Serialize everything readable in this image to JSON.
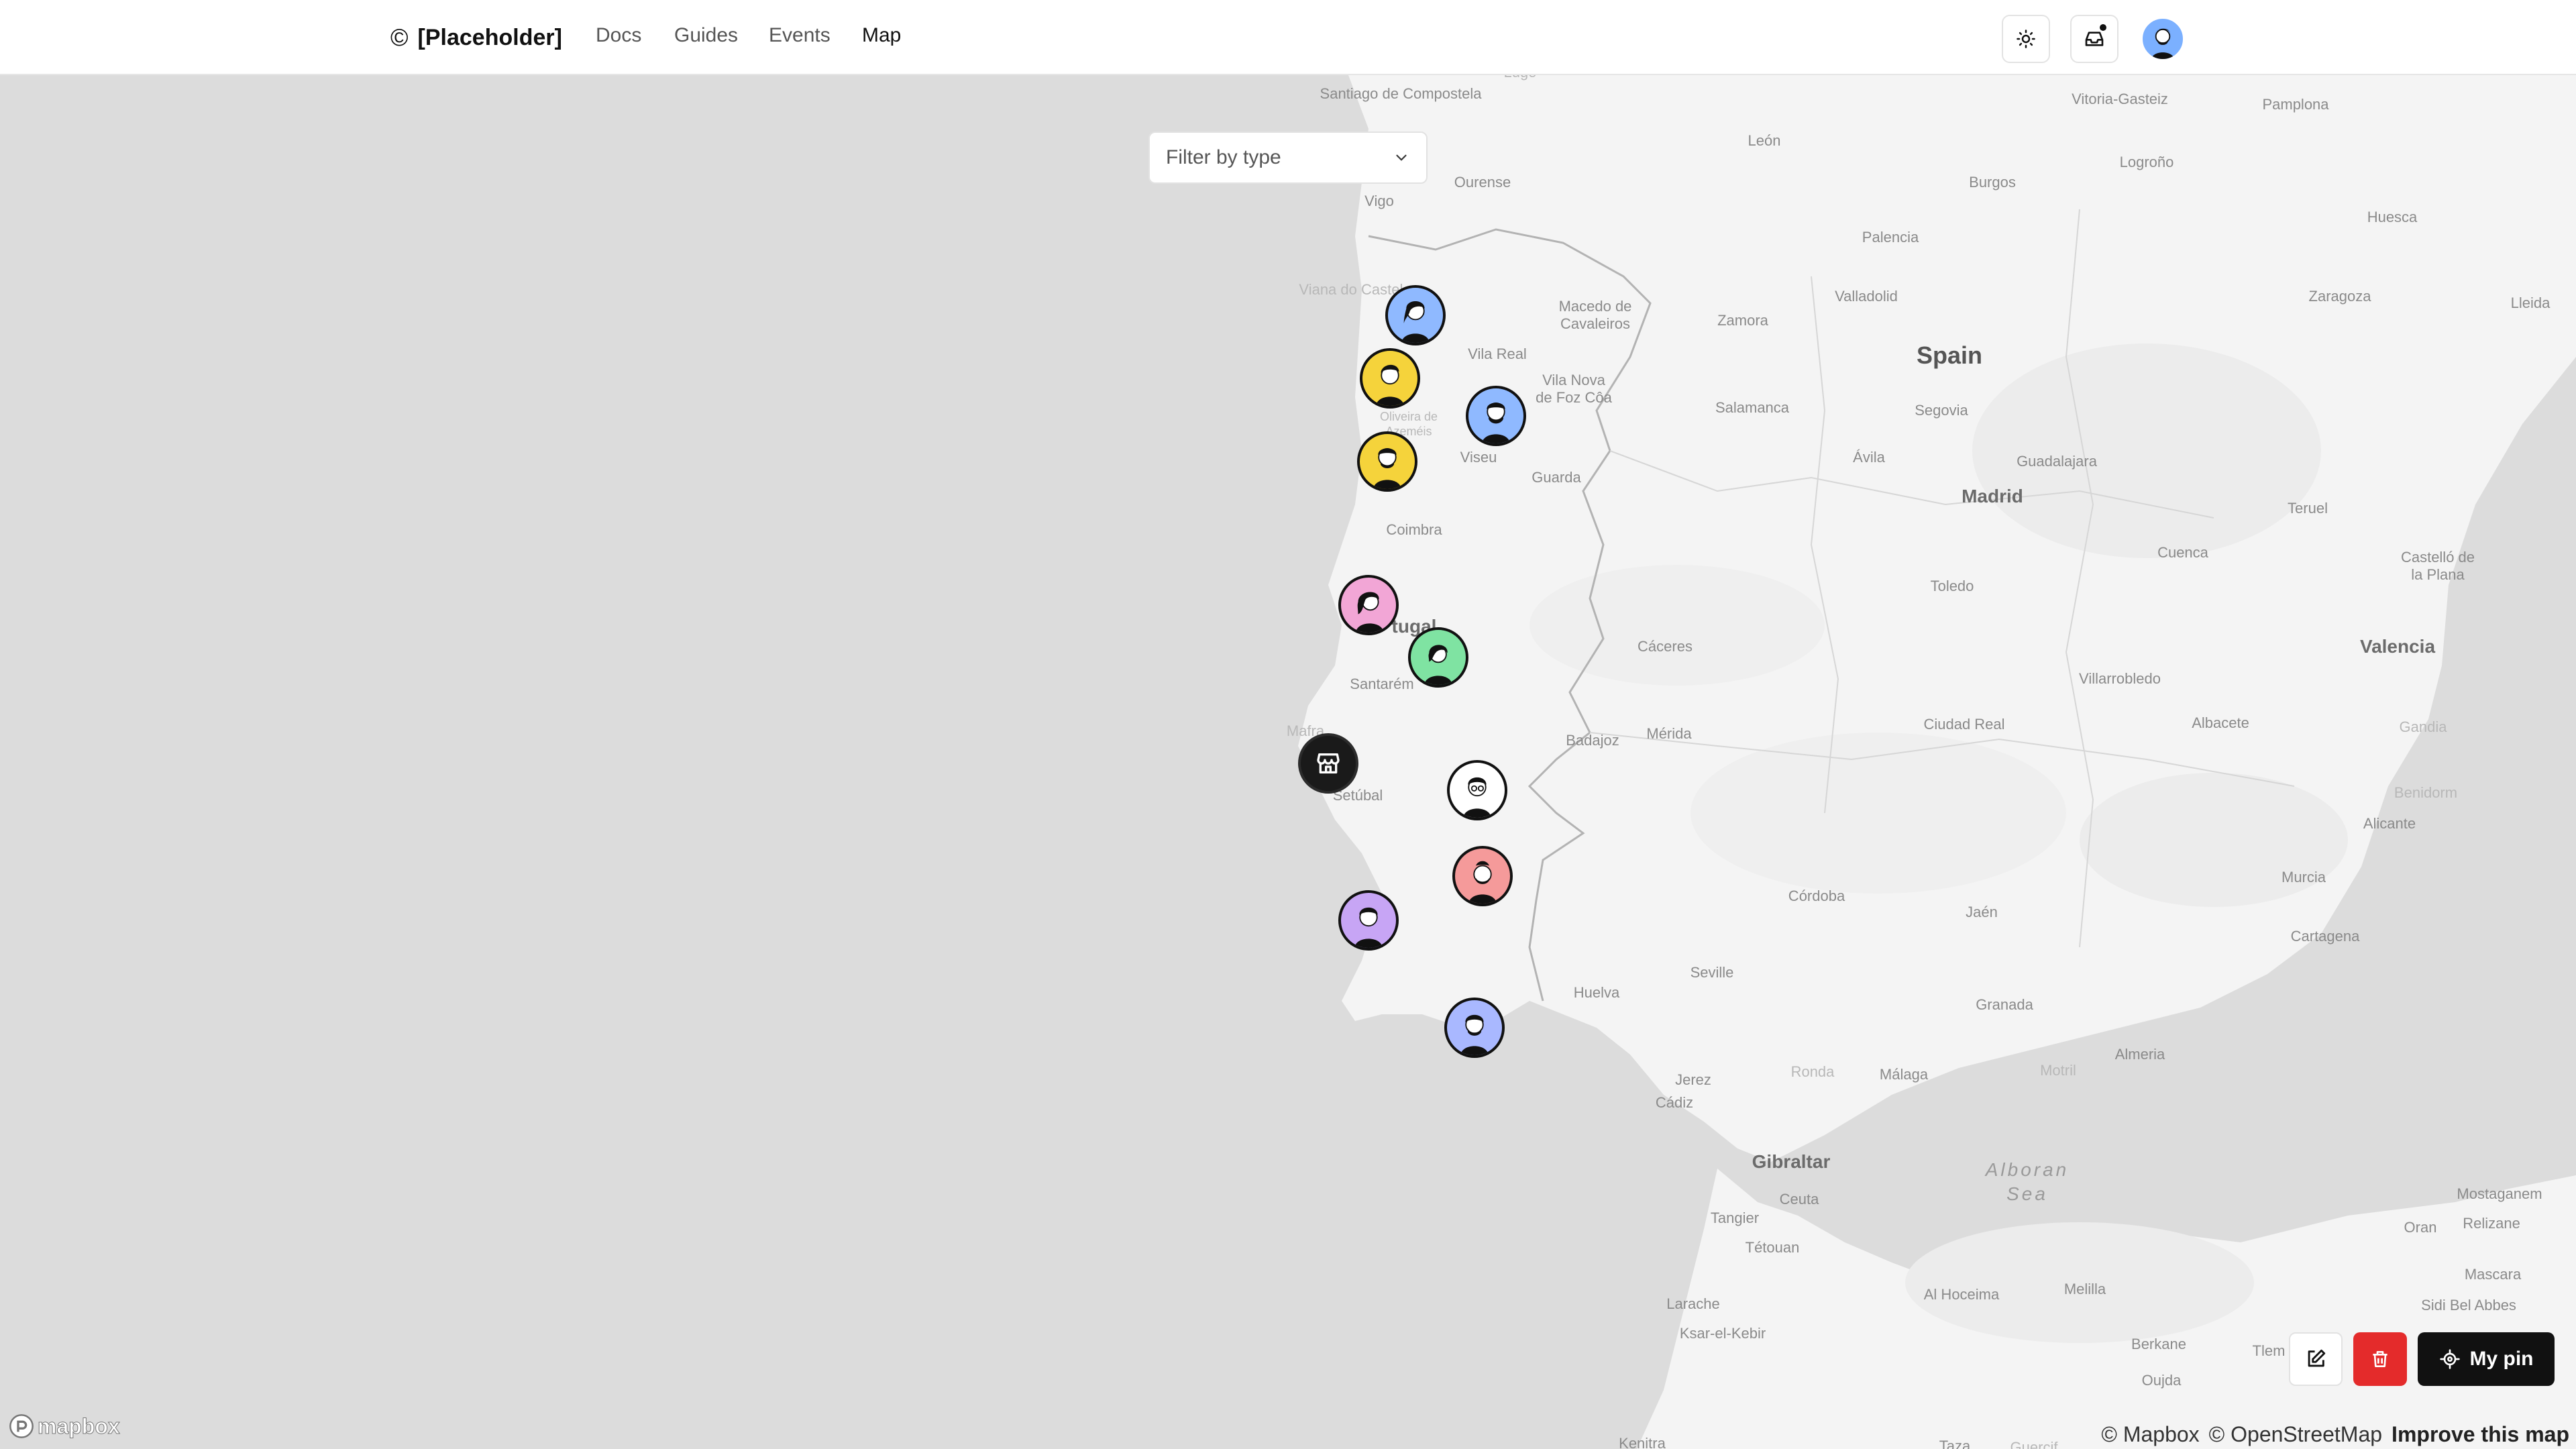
{
  "header": {
    "logo_symbol": "©",
    "brand": "[Placeholder]",
    "nav": [
      "Docs",
      "Guides",
      "Events",
      "Map"
    ],
    "active_nav": "Map",
    "theme_icon": "sun-icon",
    "inbox_icon": "inbox-icon",
    "user_avatar": "user-avatar"
  },
  "filter": {
    "placeholder": "Filter by type",
    "icon": "chevron-down-icon"
  },
  "map": {
    "places": {
      "santiago": "Santiago de Compostela",
      "lugo": "Lugo",
      "vitoria": "Vitoria-Gasteiz",
      "pamplona": "Pamplona",
      "leon": "León",
      "logrono": "Logroño",
      "ourense": "Ourense",
      "burgos": "Burgos",
      "vigo": "Vigo",
      "huesca": "Huesca",
      "palencia": "Palencia",
      "viana": "Viana do Castelo",
      "macedo": "Macedo de Cavaleiros",
      "zamora": "Zamora",
      "valladolid": "Valladolid",
      "zaragoza": "Zaragoza",
      "lleida": "Lleida",
      "vilareal": "Vila Real",
      "vilanova": "Vila Nova de Foz Côa",
      "spain": "Spain",
      "salamanca": "Salamanca",
      "segovia": "Segovia",
      "oliveira": "Oliveira de Azeméis",
      "viseu": "Viseu",
      "avila": "Ávila",
      "guadalajara": "Guadalajara",
      "guarda": "Guarda",
      "madrid": "Madrid",
      "teruel": "Teruel",
      "coimbra": "Coimbra",
      "cuenca": "Cuenca",
      "castellon": "Castelló de la Plana",
      "toledo": "Toledo",
      "portugal": "tugal",
      "caceres": "Cáceres",
      "valencia": "Valencia",
      "santarem": "Santarém",
      "villarrobledo": "Villarrobledo",
      "ciudadreal": "Ciudad Real",
      "albacete": "Albacete",
      "gandia": "Gandia",
      "mafra": "Mafra",
      "badajoz": "Badajoz",
      "merida": "Mérida",
      "benidorm": "Benidorm",
      "setubal": "Setúbal",
      "alicante": "Alicante",
      "murcia": "Murcia",
      "cordoba": "Córdoba",
      "jaen": "Jaén",
      "cartagena": "Cartagena",
      "seville": "Seville",
      "huelva": "Huelva",
      "granada": "Granada",
      "almeria": "Almeria",
      "jerez": "Jerez",
      "ronda": "Ronda",
      "malaga": "Málaga",
      "motril": "Motril",
      "cadiz": "Cádiz",
      "gibraltar": "Gibraltar",
      "alboran": "Alboran Sea",
      "mostaganem": "Mostaganem",
      "tangier": "Tangier",
      "ceuta": "Ceuta",
      "relizane": "Relizane",
      "oran": "Oran",
      "tetouan": "Tétouan",
      "alhoceima": "Al Hoceima",
      "mascara": "Mascara",
      "larache": "Larache",
      "melilla": "Melilla",
      "sidibelabbes": "Sidi Bel Abbes",
      "ksar": "Ksar-el-Kebir",
      "berkane": "Berkane",
      "tlemcen": "Tlem",
      "oujda": "Oujda",
      "kenitra": "Kenitra",
      "taza": "Taza",
      "guercif": "Guercif"
    },
    "pins": [
      {
        "label": "user-pin",
        "color": "#8fb9ff"
      },
      {
        "label": "user-pin",
        "color": "#f5d33b"
      },
      {
        "label": "user-pin",
        "color": "#8fb9ff"
      },
      {
        "label": "user-pin",
        "color": "#f5d33b"
      },
      {
        "label": "user-pin",
        "color": "#f2a6d6"
      },
      {
        "label": "user-pin",
        "color": "#7fe3a2"
      },
      {
        "label": "store-pin",
        "color": "#1a1a1a"
      },
      {
        "label": "user-pin",
        "color": "#ffffff"
      },
      {
        "label": "user-pin",
        "color": "#f59a9a"
      },
      {
        "label": "user-pin",
        "color": "#c7a5f5"
      },
      {
        "label": "user-pin",
        "color": "#a9b8ff"
      }
    ]
  },
  "controls": {
    "edit_icon": "edit-icon",
    "delete_icon": "trash-icon",
    "delete_color": "#e42b2b",
    "mypin_label": "My pin",
    "mypin_icon": "crosshair-icon"
  },
  "attribution": {
    "mapbox": "© Mapbox",
    "osm": "© OpenStreetMap",
    "improve": "Improve this map",
    "logo": "mapbox"
  }
}
